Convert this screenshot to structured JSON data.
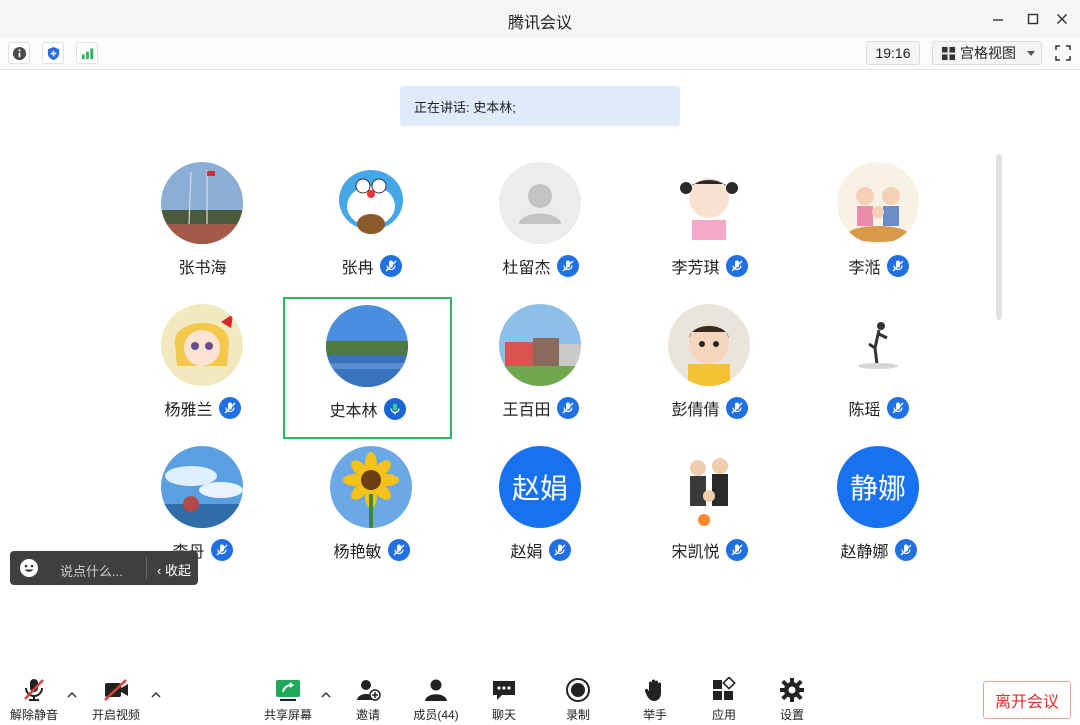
{
  "window": {
    "title": "腾讯会议"
  },
  "toolbar": {
    "time": "19:16",
    "view_label": "宫格视图"
  },
  "speaking": {
    "text": "正在讲话: 史本林;"
  },
  "participants": [
    {
      "name": "张书海",
      "mic": false,
      "avatar": "photo-sky-field"
    },
    {
      "name": "张冉",
      "mic": true,
      "avatar": "cartoon-doraemon"
    },
    {
      "name": "杜留杰",
      "mic": true,
      "avatar": "default-person"
    },
    {
      "name": "李芳琪",
      "mic": true,
      "avatar": "cartoon-girl"
    },
    {
      "name": "李湉",
      "mic": true,
      "avatar": "cartoon-family"
    },
    {
      "name": "杨雅兰",
      "mic": true,
      "avatar": "cartoon-anime-girl"
    },
    {
      "name": "史本林",
      "mic": true,
      "avatar": "photo-lake",
      "active": true
    },
    {
      "name": "王百田",
      "mic": true,
      "avatar": "photo-buildings"
    },
    {
      "name": "彭倩倩",
      "mic": true,
      "avatar": "photo-baby"
    },
    {
      "name": "陈瑶",
      "mic": true,
      "avatar": "photo-silhouette"
    },
    {
      "name": "李丹",
      "mic": true,
      "avatar": "photo-sky-tree"
    },
    {
      "name": "杨艳敏",
      "mic": true,
      "avatar": "photo-sunflower"
    },
    {
      "name": "赵娟",
      "mic": true,
      "avatar": "text",
      "avatar_text": "赵娟"
    },
    {
      "name": "宋凯悦",
      "mic": true,
      "avatar": "photo-family"
    },
    {
      "name": "赵静娜",
      "mic": true,
      "avatar": "text",
      "avatar_text": "静娜"
    }
  ],
  "chat": {
    "placeholder": "说点什么...",
    "collapse_label": "收起"
  },
  "bottom": {
    "unmute": "解除静音",
    "video": "开启视频",
    "share": "共享屏幕",
    "invite": "邀请",
    "members": "成员(44)",
    "chat": "聊天",
    "record": "录制",
    "raise_hand": "举手",
    "apps": "应用",
    "settings": "设置",
    "leave": "离开会议"
  },
  "colors": {
    "accent": "#1f6fe5",
    "active_border": "#2fb55f",
    "leave": "#d9322d",
    "banner": "#dfeafb"
  }
}
